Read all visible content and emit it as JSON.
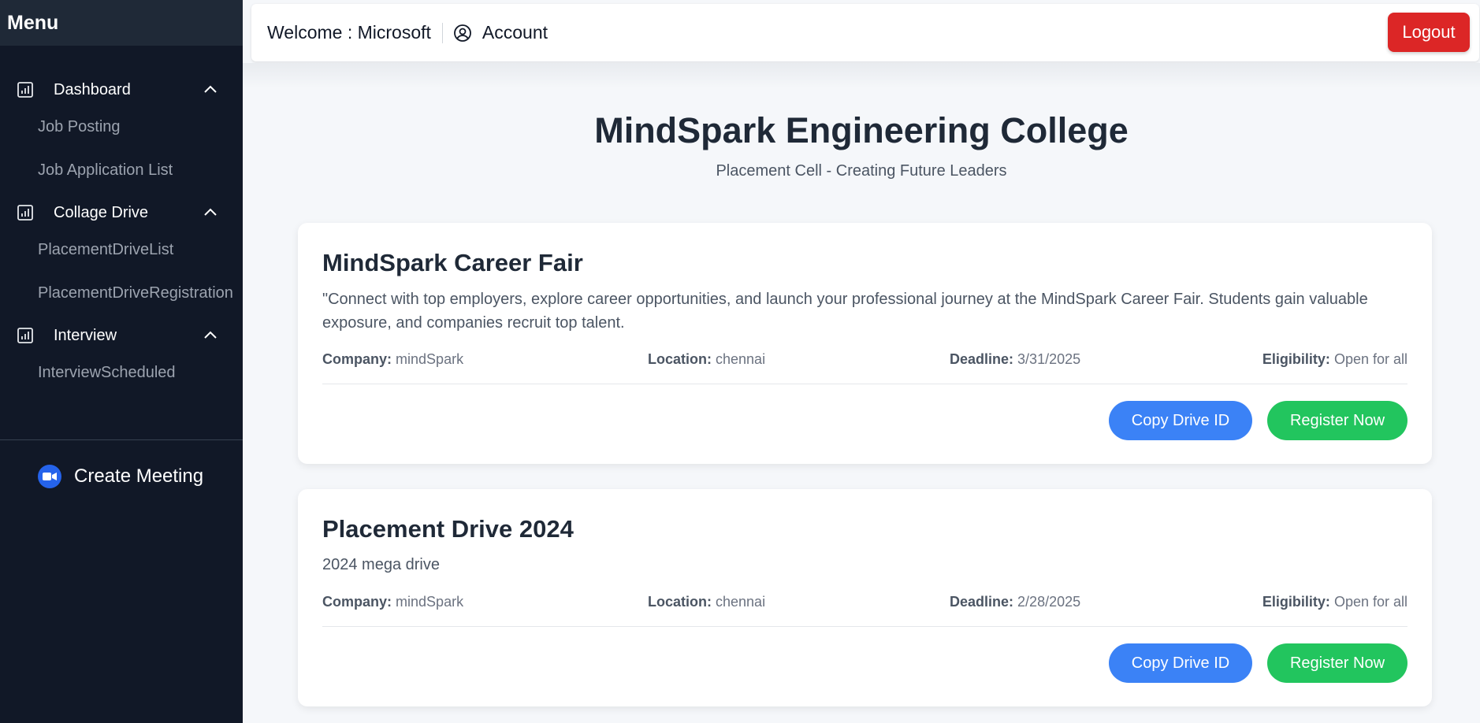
{
  "sidebar": {
    "title": "Menu",
    "sections": [
      {
        "label": "Dashboard",
        "items": [
          "Job Posting",
          "Job Application List"
        ]
      },
      {
        "label": "Collage Drive",
        "items": [
          "PlacementDriveList",
          "PlacementDriveRegistration"
        ]
      },
      {
        "label": "Interview",
        "items": [
          "InterviewScheduled"
        ]
      }
    ],
    "meeting_label": "Create Meeting"
  },
  "topbar": {
    "welcome": "Welcome : Microsoft",
    "account_label": "Account",
    "logout_label": "Logout"
  },
  "header": {
    "title": "MindSpark Engineering College",
    "subtitle": "Placement Cell - Creating Future Leaders"
  },
  "labels": {
    "company": "Company:",
    "location": "Location:",
    "deadline": "Deadline:",
    "eligibility": "Eligibility:",
    "copy_button": "Copy Drive ID",
    "register_button": "Register Now"
  },
  "drives": [
    {
      "title": "MindSpark Career Fair",
      "description": "\"Connect with top employers, explore career opportunities, and launch your professional journey at the MindSpark Career Fair. Students gain valuable exposure, and companies recruit top talent.",
      "company": "mindSpark",
      "location": "chennai",
      "deadline": "3/31/2025",
      "eligibility": "Open for all"
    },
    {
      "title": "Placement Drive 2024",
      "description": "2024 mega drive",
      "company": "mindSpark",
      "location": "chennai",
      "deadline": "2/28/2025",
      "eligibility": "Open for all"
    }
  ],
  "colors": {
    "sidebar_bg": "#111827",
    "logout": "#dc2626",
    "copy_button": "#3b82f6",
    "register_button": "#22c55e"
  }
}
